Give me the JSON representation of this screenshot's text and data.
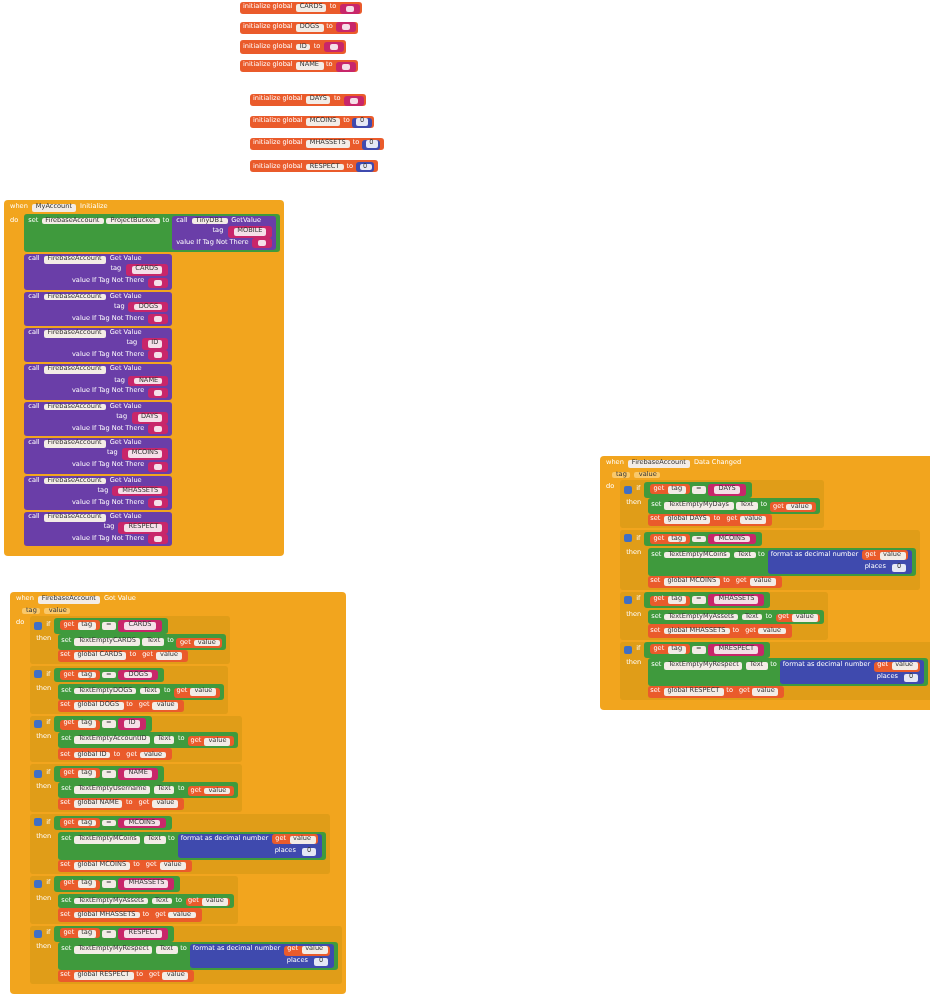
{
  "globals_top": [
    {
      "label": "initialize global",
      "name": "CARDS",
      "to": "to",
      "kind": "text"
    },
    {
      "label": "initialize global",
      "name": "DOGS",
      "to": "to",
      "kind": "text"
    },
    {
      "label": "initialize global",
      "name": "ID",
      "to": "to",
      "kind": "text"
    },
    {
      "label": "initialize global",
      "name": "NAME",
      "to": "to",
      "kind": "text"
    }
  ],
  "globals_lower": [
    {
      "label": "initialize global",
      "name": "DAYS",
      "to": "to",
      "kind": "text"
    },
    {
      "label": "initialize global",
      "name": "MCOINS",
      "to": "to",
      "kind": "number",
      "value": "0"
    },
    {
      "label": "initialize global",
      "name": "MHASSETS",
      "to": "to",
      "kind": "number",
      "value": "0"
    },
    {
      "label": "initialize global",
      "name": "RESPECT",
      "to": "to",
      "kind": "number",
      "value": "0"
    }
  ],
  "init_event": {
    "when": "when",
    "component": "MyAccount",
    "event": "Initialize",
    "do": "do",
    "set_block": {
      "set": "set",
      "component": "FirebaseAccount",
      "property": "ProjectBucket",
      "to": "to",
      "call": "call",
      "call_component": "TinyDB1",
      "method": "GetValue",
      "tag_label": "tag",
      "tag": "MOBILE",
      "default_label": "value If Tag Not There"
    },
    "calls": [
      {
        "call": "call",
        "component": "FirebaseAccount",
        "method": "Get Value",
        "tag_label": "tag",
        "tag": "CARDS",
        "default_label": "value If Tag Not There"
      },
      {
        "call": "call",
        "component": "FirebaseAccount",
        "method": "Get Value",
        "tag_label": "tag",
        "tag": "DOGS",
        "default_label": "value If Tag Not There"
      },
      {
        "call": "call",
        "component": "FirebaseAccount",
        "method": "Get Value",
        "tag_label": "tag",
        "tag": "ID",
        "default_label": "value If Tag Not There"
      },
      {
        "call": "call",
        "component": "FirebaseAccount",
        "method": "Get Value",
        "tag_label": "tag",
        "tag": "NAME",
        "default_label": "value If Tag Not There"
      },
      {
        "call": "call",
        "component": "FirebaseAccount",
        "method": "Get Value",
        "tag_label": "tag",
        "tag": "DAYS",
        "default_label": "value If Tag Not There"
      },
      {
        "call": "call",
        "component": "FirebaseAccount",
        "method": "Get Value",
        "tag_label": "tag",
        "tag": "MCOINS",
        "default_label": "value If Tag Not There"
      },
      {
        "call": "call",
        "component": "FirebaseAccount",
        "method": "Get Value",
        "tag_label": "tag",
        "tag": "MHASSETS",
        "default_label": "value If Tag Not There"
      },
      {
        "call": "call",
        "component": "FirebaseAccount",
        "method": "Get Value",
        "tag_label": "tag",
        "tag": "RESPECT",
        "default_label": "value If Tag Not There"
      }
    ]
  },
  "data_changed": {
    "when": "when",
    "component": "FirebaseAccount",
    "event": "Data Changed",
    "params": [
      "tag",
      "value"
    ],
    "do": "do",
    "branches": [
      {
        "if": "if",
        "get": "get",
        "var": "tag",
        "op": "=",
        "tag": "DAYS",
        "then": "then",
        "set": "set",
        "component": "TextEmptyMyDays",
        "property": "Text",
        "to": "to",
        "kind": "plain",
        "value_get": "get",
        "value_var": "value",
        "global_set": "set",
        "global": "global DAYS",
        "global_to": "to",
        "global_get": "get",
        "global_var": "value"
      },
      {
        "if": "if",
        "get": "get",
        "var": "tag",
        "op": "=",
        "tag": "MCOINS",
        "then": "then",
        "set": "set",
        "component": "TextEmptyMCoins",
        "property": "Text",
        "to": "to",
        "kind": "format",
        "format": "format as decimal number",
        "places_label": "places",
        "places": "0",
        "value_get": "get",
        "value_var": "value",
        "global_set": "set",
        "global": "global MCOINS",
        "global_to": "to",
        "global_get": "get",
        "global_var": "value"
      },
      {
        "if": "if",
        "get": "get",
        "var": "tag",
        "op": "=",
        "tag": "MHASSETS",
        "then": "then",
        "set": "set",
        "component": "TextEmptyMyAssets",
        "property": "Text",
        "to": "to",
        "kind": "plain",
        "value_get": "get",
        "value_var": "value",
        "global_set": "set",
        "global": "global MHASSETS",
        "global_to": "to",
        "global_get": "get",
        "global_var": "value"
      },
      {
        "if": "if",
        "get": "get",
        "var": "tag",
        "op": "=",
        "tag": "MRESPECT",
        "then": "then",
        "set": "set",
        "component": "TextEmptyMyRespect",
        "property": "Text",
        "to": "to",
        "kind": "format",
        "format": "format as decimal number",
        "places_label": "places",
        "places": "0",
        "value_get": "get",
        "value_var": "value",
        "global_set": "set",
        "global": "global RESPECT",
        "global_to": "to",
        "global_get": "get",
        "global_var": "value"
      }
    ]
  },
  "got_value": {
    "when": "when",
    "component": "FirebaseAccount",
    "event": "Got Value",
    "params": [
      "tag",
      "value"
    ],
    "do": "do",
    "branches": [
      {
        "if": "if",
        "get": "get",
        "var": "tag",
        "op": "=",
        "tag": "CARDS",
        "then": "then",
        "set": "set",
        "component": "TextEmptyCARDS",
        "property": "Text",
        "to": "to",
        "kind": "plain",
        "value_get": "get",
        "value_var": "value",
        "global_set": "set",
        "global": "global CARDS",
        "global_to": "to",
        "global_get": "get",
        "global_var": "value"
      },
      {
        "if": "if",
        "get": "get",
        "var": "tag",
        "op": "=",
        "tag": "DOGS",
        "then": "then",
        "set": "set",
        "component": "TextEmptyDOGS",
        "property": "Text",
        "to": "to",
        "kind": "plain",
        "value_get": "get",
        "value_var": "value",
        "global_set": "set",
        "global": "global DOGS",
        "global_to": "to",
        "global_get": "get",
        "global_var": "value"
      },
      {
        "if": "if",
        "get": "get",
        "var": "tag",
        "op": "=",
        "tag": "ID",
        "then": "then",
        "set": "set",
        "component": "TextEmptyAccountID",
        "property": "Text",
        "to": "to",
        "kind": "plain",
        "value_get": "get",
        "value_var": "value",
        "global_set": "set",
        "global": "global ID",
        "global_to": "to",
        "global_get": "get",
        "global_var": "value"
      },
      {
        "if": "if",
        "get": "get",
        "var": "tag",
        "op": "=",
        "tag": "NAME",
        "then": "then",
        "set": "set",
        "component": "TextEmptyUsername",
        "property": "Text",
        "to": "to",
        "kind": "plain",
        "value_get": "get",
        "value_var": "value",
        "global_set": "set",
        "global": "global NAME",
        "global_to": "to",
        "global_get": "get",
        "global_var": "value"
      },
      {
        "if": "if",
        "get": "get",
        "var": "tag",
        "op": "=",
        "tag": "MCOINS",
        "then": "then",
        "set": "set",
        "component": "TextEmptyMCoins",
        "property": "Text",
        "to": "to",
        "kind": "format",
        "format": "format as decimal number",
        "places_label": "places",
        "places": "0",
        "value_get": "get",
        "value_var": "value",
        "global_set": "set",
        "global": "global MCOINS",
        "global_to": "to",
        "global_get": "get",
        "global_var": "value"
      },
      {
        "if": "if",
        "get": "get",
        "var": "tag",
        "op": "=",
        "tag": "MHASSETS",
        "then": "then",
        "set": "set",
        "component": "TextEmptyMyAssets",
        "property": "Text",
        "to": "to",
        "kind": "plain",
        "value_get": "get",
        "value_var": "value",
        "global_set": "set",
        "global": "global MHASSETS",
        "global_to": "to",
        "global_get": "get",
        "global_var": "value"
      },
      {
        "if": "if",
        "get": "get",
        "var": "tag",
        "op": "=",
        "tag": "RESPECT",
        "then": "then",
        "set": "set",
        "component": "TextEmptyMyRespect",
        "property": "Text",
        "to": "to",
        "kind": "format",
        "format": "format as decimal number",
        "places_label": "places",
        "places": "0",
        "value_get": "get",
        "value_var": "value",
        "global_set": "set",
        "global": "global RESPECT",
        "global_to": "to",
        "global_get": "get",
        "global_var": "value"
      }
    ]
  }
}
